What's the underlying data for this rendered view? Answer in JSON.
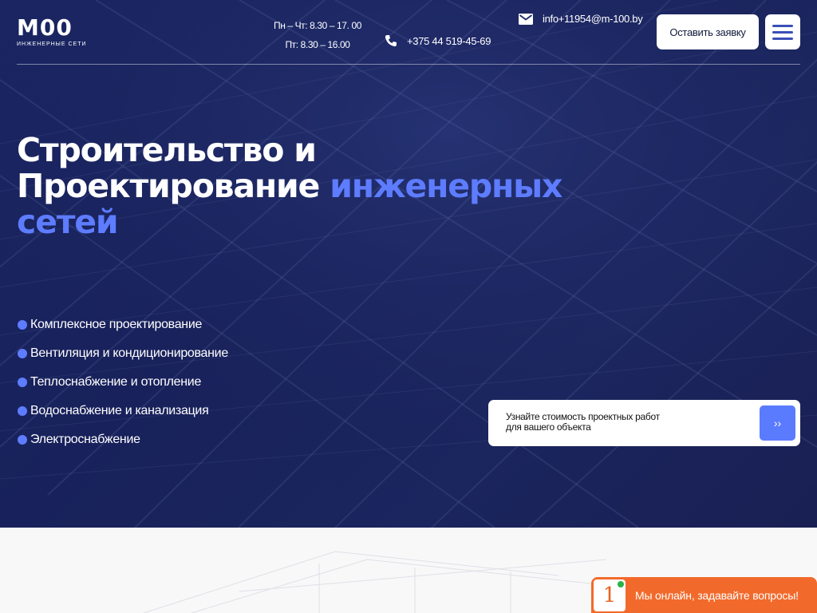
{
  "header": {
    "logo": {
      "mark": "M00",
      "subtitle": "ИНЖЕНЕРНЫЕ СЕТИ"
    },
    "schedule": {
      "weekdays": "Пн – Чт: 8.30 – 17. 00",
      "friday": "Пт: 8.30 – 16.00"
    },
    "email": "info+11954@m-100.by",
    "phone": "+375 44 519-45-69",
    "request_button": "Оставить заявку",
    "menu_icon": "hamburger-menu-icon"
  },
  "hero": {
    "title_part1": "Строительство и Проектирование ",
    "title_accent": "инженерных сетей",
    "accent_color": "#5e7cff",
    "services": [
      "Комплексное проектирование",
      "Вентиляция и кондиционирование",
      "Теплоснабжение и отопление",
      "Водоснабжение и канализация",
      "Электроснабжение"
    ]
  },
  "cta": {
    "text_line1": "Узнайте стоимость проектных работ",
    "text_line2": "для вашего объекта",
    "button": "››"
  },
  "chat": {
    "avatar": "1",
    "text": "Мы онлайн, задавайте вопросы!",
    "color": "#f26a2b"
  }
}
